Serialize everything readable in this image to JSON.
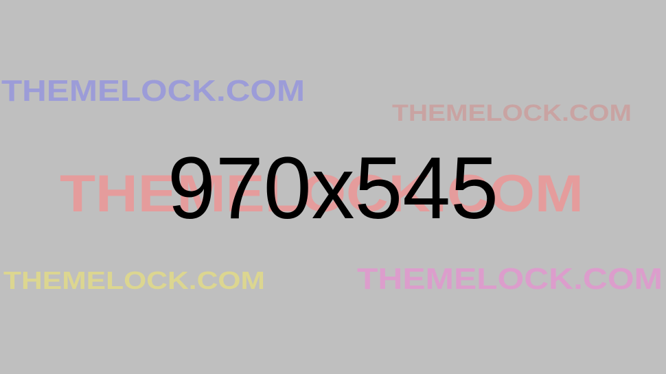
{
  "placeholder": {
    "dimensions_label": "970x545",
    "background_color": "#bfbfbf",
    "text_color": "#000000"
  },
  "watermarks": [
    {
      "text": "THEMELOCK.COM",
      "color": "#9c9cd8"
    },
    {
      "text": "THEMELOCK.COM",
      "color": "#c9a3a2"
    },
    {
      "text": "THEMELOCK.COM",
      "color": "#e59c9c"
    },
    {
      "text": "THEMELOCK.COM",
      "color": "#dcd690"
    },
    {
      "text": "THEMELOCK.COM",
      "color": "#dc9dcc"
    }
  ]
}
